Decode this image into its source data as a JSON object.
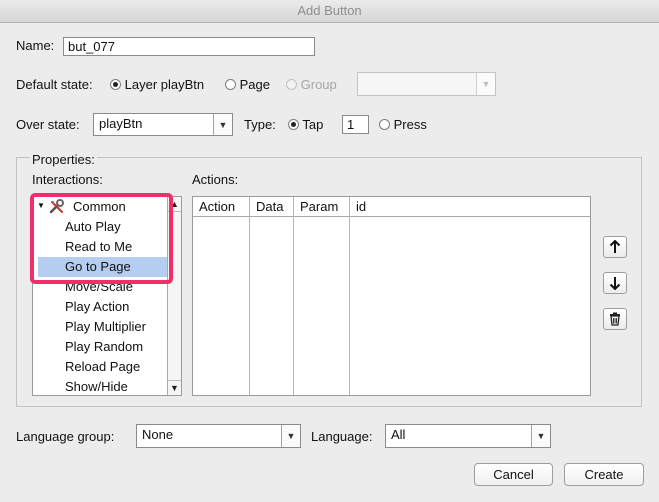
{
  "window": {
    "title": "Add Button"
  },
  "name": {
    "label": "Name:",
    "value": "but_077"
  },
  "default_state": {
    "label": "Default state:",
    "options": [
      "Layer playBtn",
      "Page",
      "Group"
    ],
    "selected": "Layer playBtn",
    "group_value": ""
  },
  "over_state": {
    "label": "Over state:",
    "value": "playBtn",
    "type_label": "Type:",
    "tap_label": "Tap",
    "tap_value": "1",
    "press_label": "Press",
    "selected_type": "Tap"
  },
  "properties": {
    "label": "Properties:",
    "interactions_label": "Interactions:",
    "actions_label": "Actions:",
    "interactions": {
      "group": "Common",
      "items": [
        "Auto Play",
        "Read to Me",
        "Go to Page",
        "Move/Scale",
        "Play Action",
        "Play Multiplier",
        "Play Random",
        "Reload Page",
        "Show/Hide"
      ],
      "selected": "Go to Page"
    },
    "actions_columns": [
      "Action",
      "Data",
      "Param",
      "id"
    ],
    "side_buttons": [
      "arrow-up-icon",
      "arrow-down-icon",
      "trash-icon"
    ]
  },
  "language_group": {
    "label": "Language group:",
    "value": "None"
  },
  "language": {
    "label": "Language:",
    "value": "All"
  },
  "buttons": {
    "cancel": "Cancel",
    "create": "Create"
  },
  "colors": {
    "highlight": "#f02e6a",
    "selection": "#b4cdf0"
  }
}
